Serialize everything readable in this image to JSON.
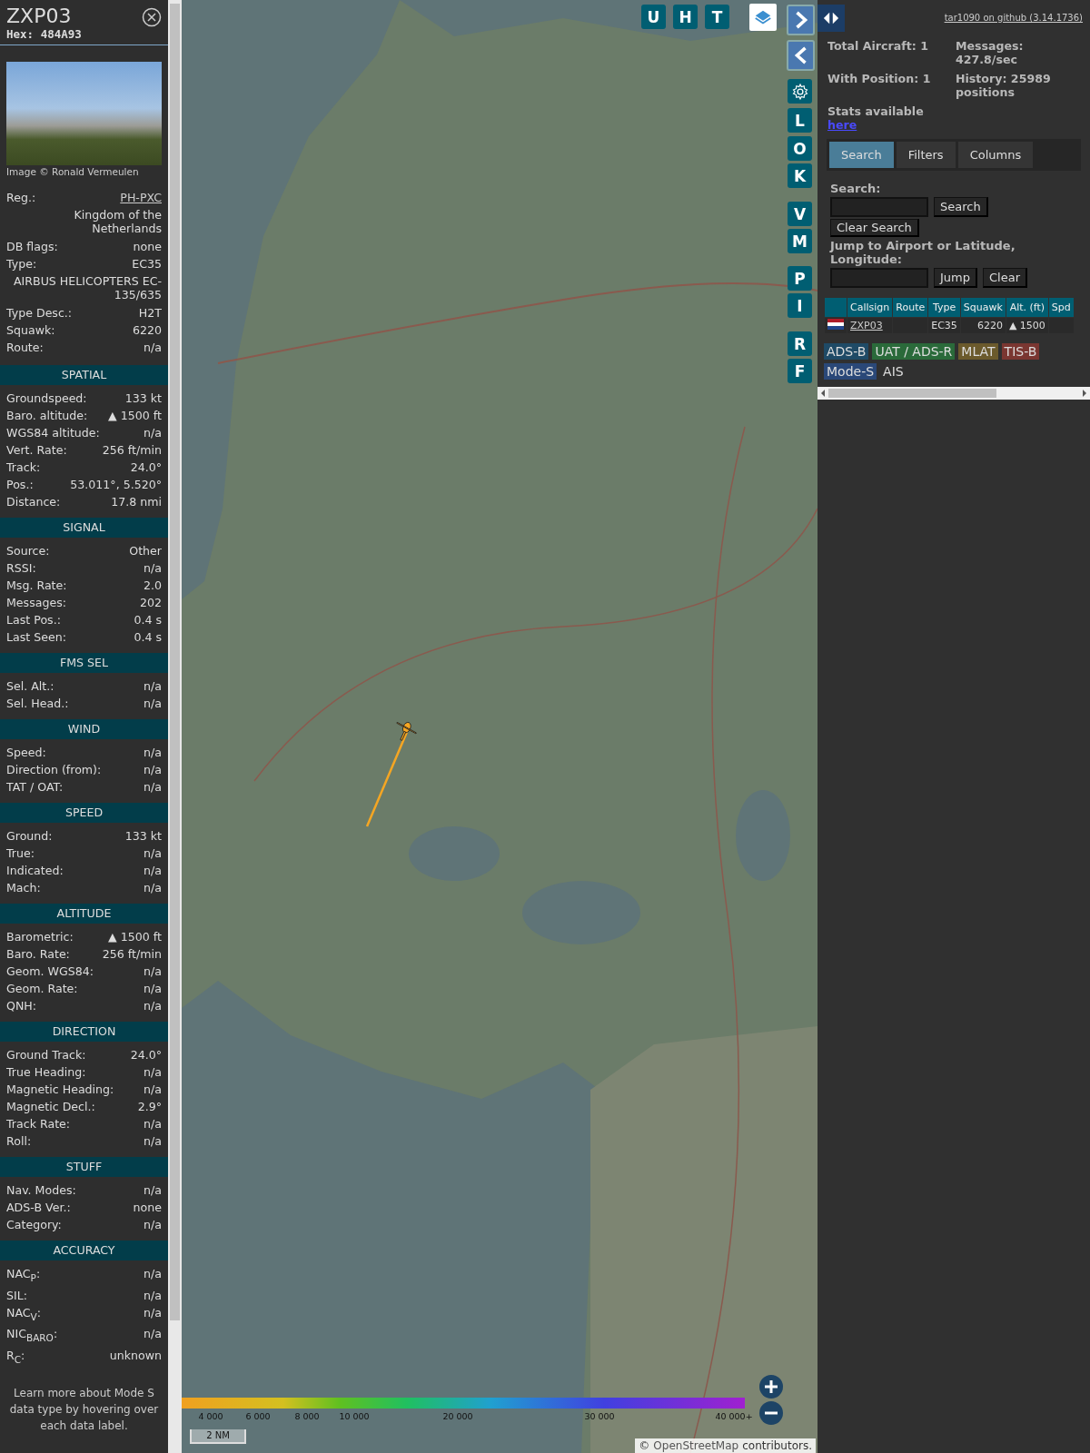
{
  "aircraft": {
    "callsign": "ZXP03",
    "hex": "Hex: 484A93",
    "photo_credit": "Image © Ronald Vermeulen",
    "info_rows": [
      {
        "kind": "link",
        "label": "Reg.:",
        "value": "PH-PXC"
      },
      {
        "kind": "full",
        "value": "Kingdom of the Netherlands"
      },
      {
        "kind": "pair",
        "label": "DB flags:",
        "value": "none"
      },
      {
        "kind": "pair",
        "label": "Type:",
        "value": "EC35"
      },
      {
        "kind": "full",
        "value": "AIRBUS HELICOPTERS EC-135/635"
      },
      {
        "kind": "pair",
        "label": "Type Desc.:",
        "value": "H2T"
      },
      {
        "kind": "pair",
        "label": "Squawk:",
        "value": "6220"
      },
      {
        "kind": "pair",
        "label": "Route:",
        "value": "n/a"
      }
    ]
  },
  "sections": [
    {
      "title": "SPATIAL",
      "rows": [
        {
          "label": "Groundspeed:",
          "value": "133 kt"
        },
        {
          "label": "Baro. altitude:",
          "value": "▲ 1500 ft"
        },
        {
          "label": "WGS84 altitude:",
          "value": "n/a"
        },
        {
          "label": "Vert. Rate:",
          "value": "256 ft/min"
        },
        {
          "label": "Track:",
          "value": "24.0°"
        },
        {
          "label": "Pos.:",
          "value": "53.011°, 5.520°"
        },
        {
          "label": "Distance:",
          "value": "17.8 nmi"
        }
      ]
    },
    {
      "title": "SIGNAL",
      "rows": [
        {
          "label": "Source:",
          "value": "Other"
        },
        {
          "label": "RSSI:",
          "value": "n/a"
        },
        {
          "label": "Msg. Rate:",
          "value": "2.0"
        },
        {
          "label": "Messages:",
          "value": "202"
        },
        {
          "label": "Last Pos.:",
          "value": "0.4 s"
        },
        {
          "label": "Last Seen:",
          "value": "0.4 s"
        }
      ]
    },
    {
      "title": "FMS SEL",
      "rows": [
        {
          "label": "Sel. Alt.:",
          "value": "n/a"
        },
        {
          "label": "Sel. Head.:",
          "value": "n/a"
        }
      ]
    },
    {
      "title": "WIND",
      "rows": [
        {
          "label": "Speed:",
          "value": "n/a"
        },
        {
          "label": "Direction (from):",
          "value": "n/a"
        },
        {
          "label": "TAT / OAT:",
          "value": "n/a"
        }
      ]
    },
    {
      "title": "SPEED",
      "rows": [
        {
          "label": "Ground:",
          "value": "133 kt"
        },
        {
          "label": "True:",
          "value": "n/a"
        },
        {
          "label": "Indicated:",
          "value": "n/a"
        },
        {
          "label": "Mach:",
          "value": "n/a"
        }
      ]
    },
    {
      "title": "ALTITUDE",
      "rows": [
        {
          "label": "Barometric:",
          "value": "▲ 1500 ft"
        },
        {
          "label": "Baro. Rate:",
          "value": "256 ft/min"
        },
        {
          "label": "Geom. WGS84:",
          "value": "n/a"
        },
        {
          "label": "Geom. Rate:",
          "value": "n/a"
        },
        {
          "label": "QNH:",
          "value": "n/a"
        }
      ]
    },
    {
      "title": "DIRECTION",
      "rows": [
        {
          "label": "Ground Track:",
          "value": "24.0°"
        },
        {
          "label": "True Heading:",
          "value": "n/a"
        },
        {
          "label": "Magnetic Heading:",
          "value": "n/a"
        },
        {
          "label": "Magnetic Decl.:",
          "value": "2.9°"
        },
        {
          "label": "Track Rate:",
          "value": "n/a"
        },
        {
          "label": "Roll:",
          "value": "n/a"
        }
      ]
    },
    {
      "title": "STUFF",
      "rows": [
        {
          "label": "Nav. Modes:",
          "value": "n/a"
        },
        {
          "label": "ADS-B Ver.:",
          "value": "none"
        },
        {
          "label": "Category:",
          "value": "n/a"
        }
      ]
    },
    {
      "title": "ACCURACY",
      "rows": [
        {
          "label": "NAC$_{P}$:",
          "value": "n/a"
        },
        {
          "label": "SIL:",
          "value": "n/a"
        },
        {
          "label": "NAC$_{V}$:",
          "value": "n/a"
        },
        {
          "label": "NIC$_{BARO}$:",
          "value": "n/a"
        },
        {
          "label": "R$_{C}$:",
          "value": "unknown"
        }
      ]
    }
  ],
  "side_note": "Learn more about Mode S data type by hovering over each data label.",
  "map": {
    "top_buttons": [
      "U",
      "H",
      "T"
    ],
    "side_buttons": [
      "L",
      "O",
      "K",
      "V",
      "M",
      "P",
      "I",
      "R",
      "F"
    ],
    "legend": {
      "labels": [
        "4 000",
        "6 000",
        "8 000",
        "10 000",
        "20 000",
        "30 000",
        "40 000+"
      ]
    },
    "scale": "2 NM",
    "attribution_prefix": "©",
    "attribution_link": "OpenStreetMap",
    "attribution_suffix": "contributors."
  },
  "panel": {
    "github_link": "tar1090 on github (3.14.1736)",
    "stats": [
      "Total Aircraft: 1",
      "Messages: 427.8/sec",
      "With Position: 1",
      "History: 25989 positions"
    ],
    "stats_text": "Stats available",
    "stats_link": "here",
    "tabs": [
      {
        "label": "Search",
        "selected": true
      },
      {
        "label": "Filters",
        "selected": false
      },
      {
        "label": "Columns",
        "selected": false
      }
    ],
    "search_label": "Search:",
    "search_button": "Search",
    "clear_search_button": "Clear Search",
    "jump_label": "Jump to Airport or Latitude, Longitude:",
    "jump_button": "Jump",
    "clear_button": "Clear",
    "table": {
      "columns": [
        "Callsign",
        "Route",
        "Type",
        "Squawk",
        "Alt. (ft)",
        "Spd"
      ],
      "rows": [
        {
          "callsign": "ZXP03",
          "type": "EC35",
          "squawk": "6220",
          "altitude": "▲ 1500"
        }
      ]
    },
    "sources": [
      {
        "label": "ADS-B",
        "color": "#1f4a66"
      },
      {
        "label": "UAT / ADS-R",
        "color": "#2a6a3a"
      },
      {
        "label": "MLAT",
        "color": "#6b5a2c"
      },
      {
        "label": "TIS-B",
        "color": "#7a3631"
      },
      {
        "label": "Mode-S",
        "color": "#2a4878"
      },
      {
        "label": "AIS"
      }
    ]
  }
}
